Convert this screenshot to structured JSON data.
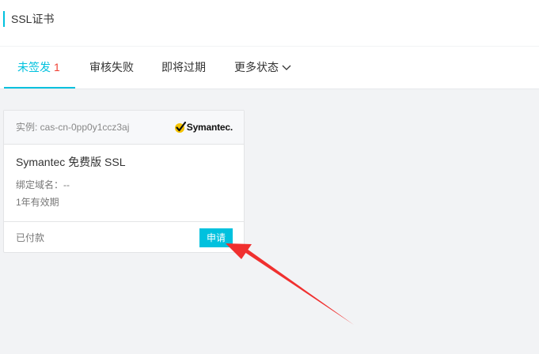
{
  "header": {
    "title": "SSL证书"
  },
  "tabs": [
    {
      "label": "未签发",
      "count": "1"
    },
    {
      "label": "审核失败"
    },
    {
      "label": "即将过期"
    },
    {
      "label": "更多状态"
    }
  ],
  "card": {
    "instance": "实例: cas-cn-0pp0y1ccz3aj",
    "brand": "Symantec.",
    "product": "Symantec 免费版 SSL",
    "domain": "绑定域名：--",
    "validity": "1年有效期",
    "payment_status": "已付款",
    "apply_label": "申请"
  },
  "colors": {
    "accent": "#00c1de",
    "count": "#f04134",
    "annotation_arrow": "#f0302f"
  },
  "icons": {
    "brand_logo": "symantec-check-icon",
    "more_status": "chevron-down-icon",
    "annotation": "red-arrow-annotation"
  }
}
